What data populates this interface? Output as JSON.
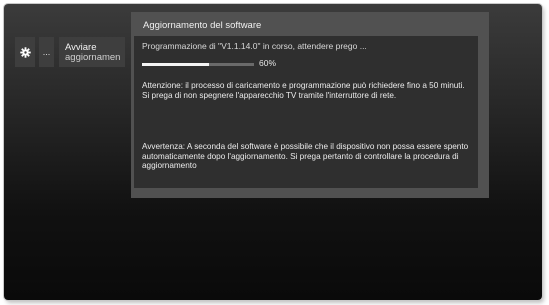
{
  "toolbar": {
    "gear_icon": "gear-icon",
    "more_label": "...",
    "start_update_line1": "Avviare",
    "start_update_line2": "aggiornamen"
  },
  "dialog": {
    "title": "Aggiornamento del software",
    "progress_text": "Programmazione di \"V1.1.14.0\" in corso, attendere prego ...",
    "progress_percent": 60,
    "progress_label": "60%",
    "attention_text": "Attenzione: il processo di caricamento e programmazione può richiedere fino a 50 minuti. Si prega di non spegnere l'apparecchio TV tramite l'interruttore di rete.",
    "warning_text": "Avvertenza: A seconda del software è possibile che il dispositivo non possa essere spento automaticamente dopo l'aggiornamento. Si prega pertanto di controllare la procedura di aggiornamento"
  }
}
